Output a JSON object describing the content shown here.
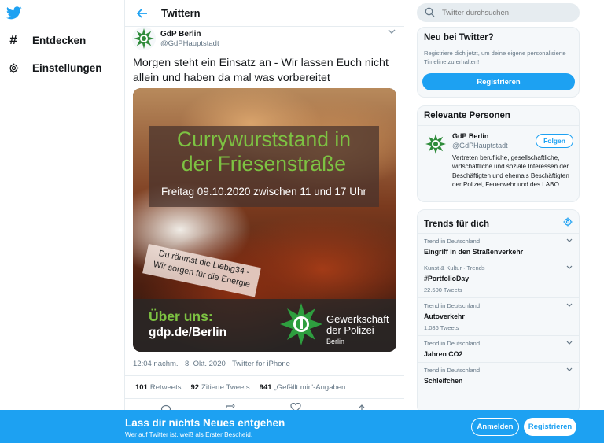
{
  "nav": {
    "items": [
      {
        "label": "Entdecken",
        "icon": "hashtag-icon"
      },
      {
        "label": "Einstellungen",
        "icon": "gear-icon"
      }
    ]
  },
  "header": {
    "title": "Twittern"
  },
  "tweet": {
    "author_name": "GdP Berlin",
    "author_handle": "@GdPHauptstadt",
    "text": "Morgen steht ein Einsatz an - Wir lassen Euch nicht allein und haben da mal was vorbereitet",
    "media": {
      "title_line1": "Currywurststand in",
      "title_line2": "der Friesenstraße",
      "date": "Freitag 09.10.2020 zwischen 11 und 17 Uhr",
      "banner_line1": "Du räumst die Liebig34 -",
      "banner_line2": "Wir sorgen für die Energie",
      "about_label": "Über uns:",
      "url": "gdp.de/Berlin",
      "org_line1": "Gewerkschaft",
      "org_line2": "der Polizei",
      "org_city": "Berlin"
    },
    "meta": "12:04 nachm. · 8. Okt. 2020 · Twitter for iPhone",
    "stats": [
      {
        "count": "101",
        "label": "Retweets"
      },
      {
        "count": "92",
        "label": "Zitierte Tweets"
      },
      {
        "count": "941",
        "label": "„Gefällt mir“-Angaben"
      }
    ]
  },
  "sidebar": {
    "search_placeholder": "Twitter durchsuchen",
    "signup": {
      "title": "Neu bei Twitter?",
      "desc": "Registriere dich jetzt, um deine eigene personalisierte Timeline zu erhalten!",
      "button": "Registrieren"
    },
    "people": {
      "title": "Relevante Personen",
      "name": "GdP Berlin",
      "handle": "@GdPHauptstadt",
      "follow": "Folgen",
      "bio": "Vertreten berufliche, gesellschaftliche, wirtschaftliche und soziale Interessen der Beschäftigten und ehemals Beschäftigten der Polizei, Feuerwehr und des LABO"
    },
    "trends": {
      "title": "Trends für dich",
      "items": [
        {
          "context": "Trend in Deutschland",
          "name": "Eingriff in den Straßenverkehr",
          "count": ""
        },
        {
          "context": "Kunst & Kultur · Trends",
          "name": "#PortfolioDay",
          "count": "22.500 Tweets"
        },
        {
          "context": "Trend in Deutschland",
          "name": "Autoverkehr",
          "count": "1.086 Tweets"
        },
        {
          "context": "Trend in Deutschland",
          "name": "Jahren CO2",
          "count": ""
        },
        {
          "context": "Trend in Deutschland",
          "name": "Schleifchen",
          "count": ""
        }
      ]
    }
  },
  "bottom_bar": {
    "title": "Lass dir nichts Neues entgehen",
    "subtitle": "Wer auf Twitter ist, weiß als Erster Bescheid.",
    "login": "Anmelden",
    "register": "Registrieren"
  },
  "colors": {
    "accent": "#1da1f2",
    "green": "#7dc242",
    "text": "#14171a",
    "muted": "#657786"
  }
}
